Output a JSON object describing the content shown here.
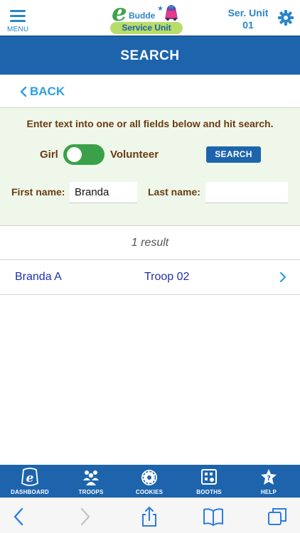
{
  "header": {
    "menu_label": "MENU",
    "logo_letter": "e",
    "logo_brand": "Budde",
    "logo_subtitle": "Service Unit",
    "unit_line1": "Ser. Unit",
    "unit_line2": "01",
    "settings_icon": "gear-icon"
  },
  "title": "SEARCH",
  "back_label": "BACK",
  "search": {
    "instructions": "Enter text into one or all fields below and hit search.",
    "toggle_left": "Girl",
    "toggle_right": "Volunteer",
    "button_label": "SEARCH",
    "first_name_label": "First name:",
    "first_name_value": "Branda",
    "last_name_label": "Last name:",
    "last_name_value": ""
  },
  "results": {
    "count_text": "1 result",
    "rows": [
      {
        "name": "Branda A",
        "troop": "Troop 02"
      }
    ]
  },
  "bottom_nav": [
    {
      "label": "DASHBOARD",
      "icon": "ebudde-logo-icon"
    },
    {
      "label": "TROOPS",
      "icon": "troops-icon"
    },
    {
      "label": "COOKIES",
      "icon": "cookie-icon"
    },
    {
      "label": "BOOTHS",
      "icon": "booth-icon"
    },
    {
      "label": "HELP",
      "icon": "help-icon"
    }
  ],
  "colors": {
    "primary_blue": "#1d64ad",
    "accent_blue": "#2a86c9",
    "link_blue": "#2aa0e0",
    "toggle_green": "#3aa148",
    "label_brown": "#6b3b12",
    "panel_bg": "#eef7ea"
  }
}
